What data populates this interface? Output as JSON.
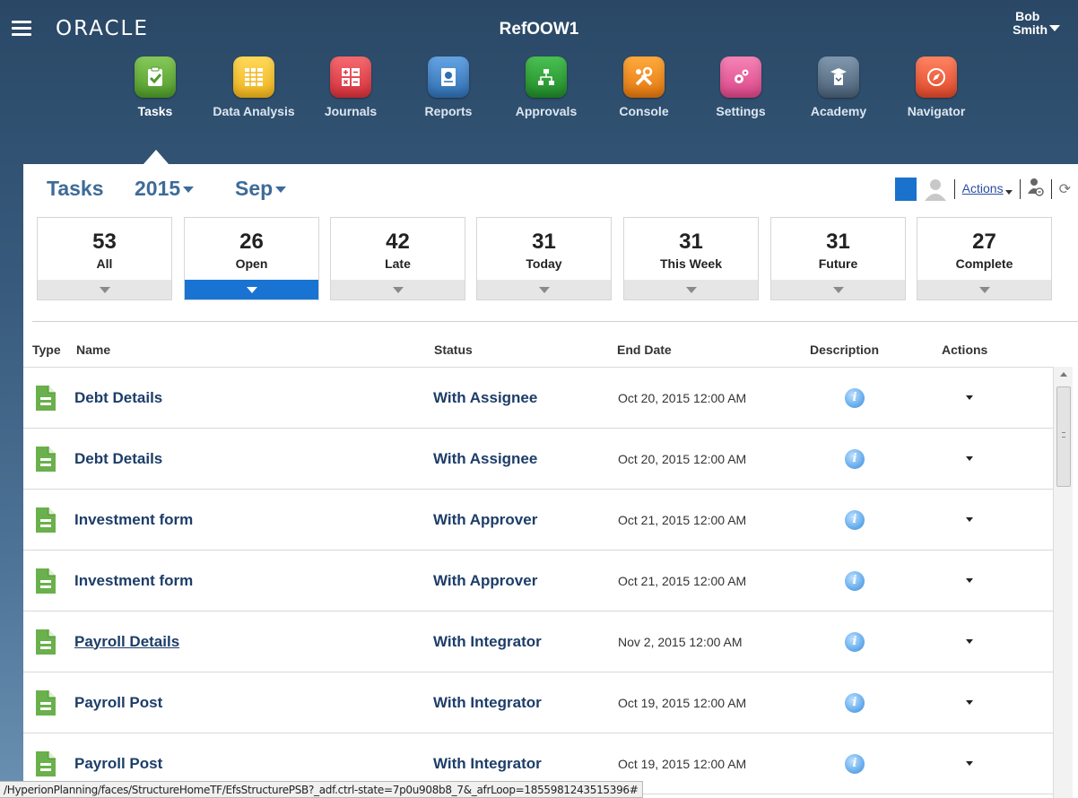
{
  "header": {
    "brand": "ORACLE",
    "app_title": "RefOOW1",
    "user_first": "Bob",
    "user_last": "Smith"
  },
  "nav": {
    "items": [
      {
        "label": "Tasks",
        "icon": "clipboard-check-icon",
        "color": "#5fa737"
      },
      {
        "label": "Data Analysis",
        "icon": "grid-icon",
        "color": "#f2c12e"
      },
      {
        "label": "Journals",
        "icon": "calculator-icon",
        "color": "#e8474f"
      },
      {
        "label": "Reports",
        "icon": "report-icon",
        "color": "#3e83c9"
      },
      {
        "label": "Approvals",
        "icon": "org-chart-icon",
        "color": "#2fa338"
      },
      {
        "label": "Console",
        "icon": "tools-icon",
        "color": "#f08a1c"
      },
      {
        "label": "Settings",
        "icon": "gears-icon",
        "color": "#e95d9c"
      },
      {
        "label": "Academy",
        "icon": "academy-icon",
        "color": "#5a7088"
      },
      {
        "label": "Navigator",
        "icon": "compass-icon",
        "color": "#ef5f3c"
      }
    ],
    "active": "Tasks"
  },
  "toolbar": {
    "title": "Tasks",
    "year": "2015",
    "month": "Sep",
    "actions_label": "Actions"
  },
  "tiles": [
    {
      "count": "53",
      "label": "All"
    },
    {
      "count": "26",
      "label": "Open"
    },
    {
      "count": "42",
      "label": "Late"
    },
    {
      "count": "31",
      "label": "Today"
    },
    {
      "count": "31",
      "label": "This Week"
    },
    {
      "count": "31",
      "label": "Future"
    },
    {
      "count": "27",
      "label": "Complete"
    }
  ],
  "table": {
    "columns": {
      "type": "Type",
      "name": "Name",
      "status": "Status",
      "end_date": "End Date",
      "description": "Description",
      "actions": "Actions"
    },
    "rows": [
      {
        "name": "Debt Details",
        "status": "With Assignee",
        "end_date": "Oct 20, 2015 12:00 AM"
      },
      {
        "name": "Debt Details",
        "status": "With Assignee",
        "end_date": "Oct 20, 2015 12:00 AM"
      },
      {
        "name": "Investment form",
        "status": "With Approver",
        "end_date": "Oct 21, 2015 12:00 AM"
      },
      {
        "name": "Investment form",
        "status": "With Approver",
        "end_date": "Oct 21, 2015 12:00 AM"
      },
      {
        "name": "Payroll Details",
        "status": "With Integrator",
        "end_date": "Nov 2, 2015 12:00 AM"
      },
      {
        "name": "Payroll Post",
        "status": "With Integrator",
        "end_date": "Oct 19, 2015 12:00 AM"
      },
      {
        "name": "Payroll Post",
        "status": "With Integrator",
        "end_date": "Oct 19, 2015 12:00 AM"
      }
    ]
  },
  "statusbar": {
    "url": "/HyperionPlanning/faces/StructureHomeTF/EfsStructurePSB?_adf.ctrl-state=7p0u908b8_7&_afrLoop=1855981243515396#"
  }
}
